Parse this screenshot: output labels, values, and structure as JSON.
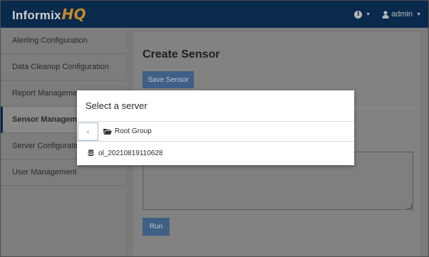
{
  "header": {
    "logo_text": "Informix",
    "logo_hq": "HQ",
    "info_glyph": "i",
    "user_label": "admin"
  },
  "sidebar": {
    "items": [
      {
        "label": "Alerting Configuration",
        "active": false
      },
      {
        "label": "Data Cleanup Configuration",
        "active": false
      },
      {
        "label": "Report Management",
        "active": false
      },
      {
        "label": "Sensor Management",
        "active": true
      },
      {
        "label": "Server Configuration",
        "active": false
      },
      {
        "label": "User Management",
        "active": false
      }
    ]
  },
  "main": {
    "title": "Create Sensor",
    "save_label": "Save Sensor",
    "run_label": "Run"
  },
  "modal": {
    "title": "Select a server",
    "back_glyph": "‹",
    "group_label": "Root Group",
    "server_label": "ol_20210819110628"
  },
  "colors": {
    "header_bg": "#0a2a4d",
    "logo_accent": "#c08a2a",
    "button_bg": "#3f5f86"
  },
  "icons": [
    "info-icon",
    "user-icon",
    "folder-open-icon",
    "database-icon",
    "chevron-left-icon"
  ]
}
